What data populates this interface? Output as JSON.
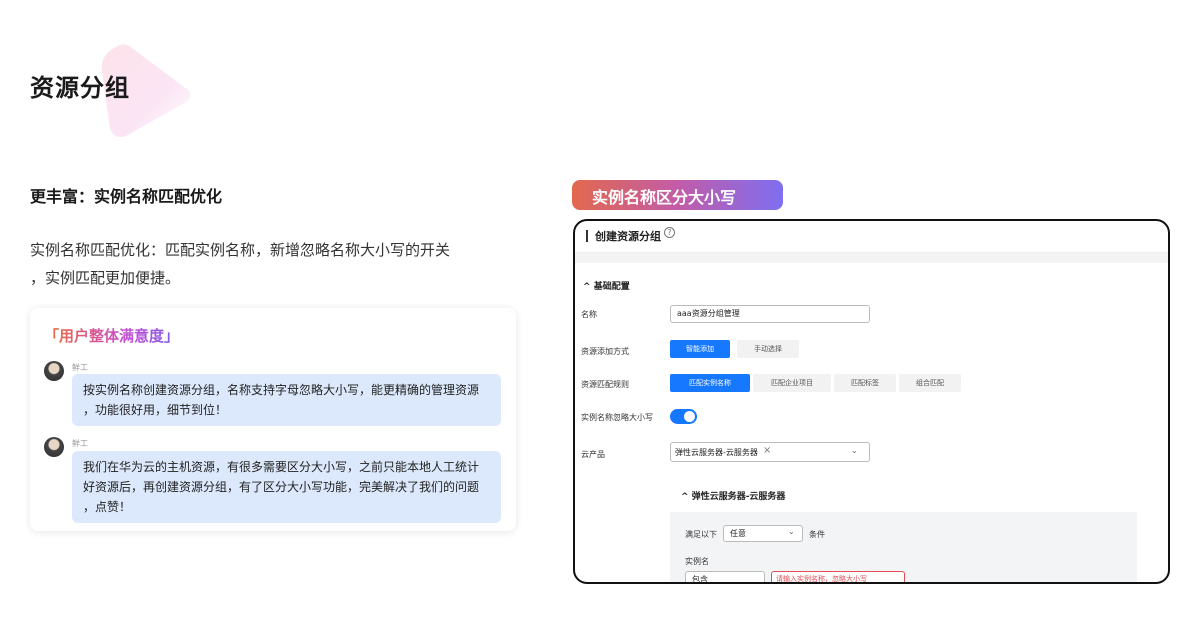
{
  "page": {
    "title": "资源分组",
    "subtitle": "更丰富：实例名称匹配优化",
    "description": "实例名称匹配优化：匹配实例名称，新增忽略名称大小写的开关，实例匹配更加便捷。",
    "description_lines": [
      "实例名称匹配优化：匹配实例名称，新增忽略名称大小写的开关",
      "，实例匹配更加便捷。"
    ]
  },
  "satisfaction": {
    "title": "「用户整体满意度」",
    "comments": [
      {
        "user": "鲜工",
        "lines": [
          "按实例名称创建资源分组，名称支持字母忽略大小写，能更精确的管理资源",
          "，功能很好用，细节到位！"
        ]
      },
      {
        "user": "鲜工",
        "lines": [
          "我们在华为云的主机资源，有很多需要区分大小写，之前只能本地人工统计",
          "好资源后，再创建资源分组，有了区分大小写功能，完美解决了我们的问题",
          "，点赞！"
        ]
      }
    ]
  },
  "badge": {
    "label": "实例名称区分大小写"
  },
  "screenshot": {
    "header_title": "创建资源分组",
    "help_icon": "question-circle-icon",
    "section_title": "基础配置",
    "fields": {
      "name": {
        "label": "名称",
        "value": "aaa资源分组管理"
      },
      "add_mode": {
        "label": "资源添加方式",
        "options": [
          "智能添加",
          "手动选择"
        ],
        "selected": "智能添加"
      },
      "match_rule": {
        "label": "资源匹配规则",
        "options": [
          "匹配实例名称",
          "匹配企业项目",
          "匹配标签",
          "组合匹配"
        ],
        "selected": "匹配实例名称"
      },
      "ignore_case": {
        "label": "实例名称忽略大小写",
        "on": true
      },
      "cloud_product": {
        "label": "云产品",
        "tag": "弹性云服务器-云服务器"
      }
    },
    "sub_section": {
      "title": "弹性云服务器-云服务器",
      "condition_prefix": "满足以下",
      "condition_select": "任意",
      "condition_suffix": "条件",
      "instance_name_label": "实例名",
      "operator_select": "包含",
      "error_input_text": "请输入实例名称，忽略大小写"
    }
  },
  "colors": {
    "accent_blue": "#1677ff",
    "badge_gradient": [
      "#e2694e",
      "#c25ca8",
      "#7e6ef0"
    ],
    "bubble_bg": "#dce8fb"
  }
}
